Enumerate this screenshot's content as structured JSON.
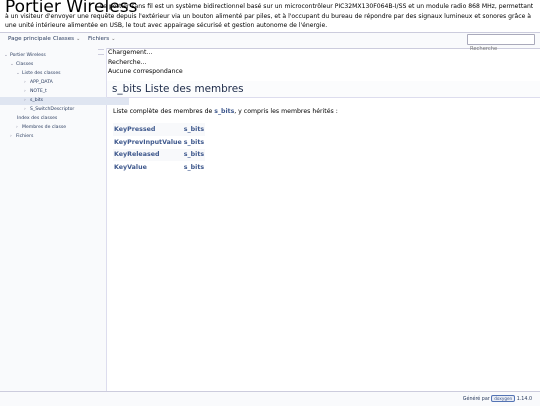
{
  "header": {
    "project_name": "Portier Wireless",
    "project_brief": "Le portier sans fil est un système bidirectionnel basé sur un microcontrôleur PIC32MX130F064B-I/SS et un module radio 868 MHz, permettant à un visiteur d'envoyer une requête depuis l'extérieur via un bouton alimenté par piles, et à l'occupant du bureau de répondre par des signaux lumineux et sonores grâce à une unité intérieure alimentée en USB, le tout avec appairage sécurisé et gestion autonome de l'énergie."
  },
  "navbar": {
    "items": [
      {
        "label": "Page principale",
        "has_caret": false
      },
      {
        "label": "Classes",
        "has_caret": true
      },
      {
        "label": "Fichiers",
        "has_caret": true
      }
    ],
    "search_placeholder": "Recherche",
    "caret_glyph": "⌄"
  },
  "sidenav": {
    "splitter_glyph": "··",
    "items": [
      {
        "label": "Portier Wireless",
        "arrow": "⌄",
        "indent": 0,
        "selected": false
      },
      {
        "label": "Classes",
        "arrow": "⌄",
        "indent": 1,
        "selected": false
      },
      {
        "label": "Liste des classes",
        "arrow": "⌄",
        "indent": 2,
        "selected": false
      },
      {
        "label": "APP_DATA",
        "arrow": "›",
        "indent": 3,
        "selected": false
      },
      {
        "label": "NOTE_t",
        "arrow": "›",
        "indent": 3,
        "selected": false
      },
      {
        "label": "s_bits",
        "arrow": "›",
        "indent": 3,
        "selected": true
      },
      {
        "label": "S_SwitchDescriptor",
        "arrow": "›",
        "indent": 3,
        "selected": false
      },
      {
        "label": "Index des classes",
        "arrow": "",
        "indent": 3,
        "selected": false
      },
      {
        "label": "Membres de classe",
        "arrow": "›",
        "indent": 2,
        "selected": false
      },
      {
        "label": "Fichiers",
        "arrow": "›",
        "indent": 1,
        "selected": false
      }
    ]
  },
  "content": {
    "status": [
      "Chargement...",
      "Recherche...",
      "Aucune correspondance"
    ],
    "title": "s_bits Liste des membres",
    "intro_before": "Liste complète des membres de ",
    "intro_link": "s_bits",
    "intro_after": ", y compris les membres hérités :",
    "members": [
      {
        "name": "KeyPressed",
        "class": "s_bits"
      },
      {
        "name": "KeyPrevInputValue",
        "class": "s_bits"
      },
      {
        "name": "KeyReleased",
        "class": "s_bits"
      },
      {
        "name": "KeyValue",
        "class": "s_bits"
      }
    ]
  },
  "footer": {
    "generated_by": "Généré par ",
    "logo_text": "doxygen",
    "version": "1.14.0"
  },
  "colors": {
    "link": "#3d578c",
    "nav_text": "#283a5d",
    "selected_bg": "#dfe5f1",
    "nav_bg": "#f9fafc"
  }
}
